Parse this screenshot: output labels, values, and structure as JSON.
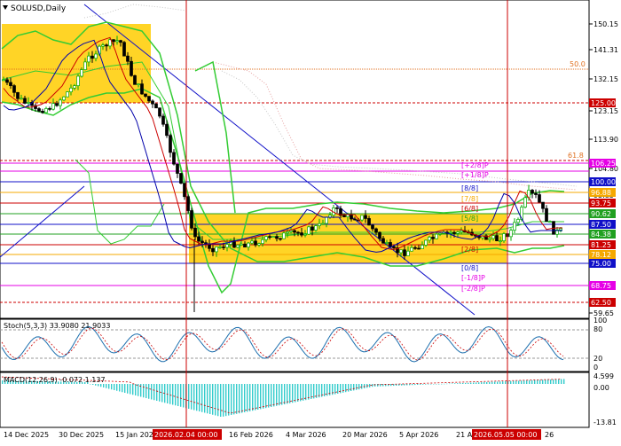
{
  "window": {
    "title": "SOLUSD,Daily"
  },
  "stochastic_panel": {
    "label": "Stoch(5,3,3) 33.9080 21.9033",
    "scale": [
      "100",
      "80",
      "20",
      "0"
    ]
  },
  "macd_panel": {
    "label": "MACD(12,26,9) -0.072 1.137",
    "scale": [
      "4.599",
      "0.00",
      "-13.81"
    ]
  },
  "price_scale": [
    "150.15",
    "141.31",
    "132.15",
    "123.15",
    "113.90",
    "104.80",
    "95.85",
    "86.88",
    "77.96",
    "68.87",
    "59.65"
  ],
  "price_badges": [
    {
      "text": "125.00",
      "color": "#cc0000"
    },
    {
      "text": "106.25",
      "color": "#e600e6"
    },
    {
      "text": "100.00",
      "color": "#1010c8"
    },
    {
      "text": "96.88",
      "color": "#f5a800"
    },
    {
      "text": "93.75",
      "color": "#cc0000"
    },
    {
      "text": "90.62",
      "color": "#20a020"
    },
    {
      "text": "87.50",
      "color": "#1010c8"
    },
    {
      "text": "84.38",
      "color": "#20a020"
    },
    {
      "text": "81.25",
      "color": "#cc0000"
    },
    {
      "text": "78.12",
      "color": "#f5a800"
    },
    {
      "text": "75.00",
      "color": "#1010c8"
    },
    {
      "text": "68.75",
      "color": "#e600e6"
    },
    {
      "text": "62.50",
      "color": "#cc0000"
    }
  ],
  "fib_labels": [
    "50.0",
    "61.8"
  ],
  "murrey_labels": [
    {
      "text": "[+2/8]P",
      "color": "#e600e6"
    },
    {
      "text": "[+1/8]P",
      "color": "#e600e6"
    },
    {
      "text": "[8/8]",
      "color": "#1010c8"
    },
    {
      "text": "[7/8]",
      "color": "#f5a800"
    },
    {
      "text": "[6/8]",
      "color": "#cc0000"
    },
    {
      "text": "[5/8]",
      "color": "#20a020"
    },
    {
      "text": "[2/8]",
      "color": "#cc0000"
    },
    {
      "text": "[0/8]",
      "color": "#1010c8"
    },
    {
      "text": "[-1/8]P",
      "color": "#e600e6"
    },
    {
      "text": "[-2/8]P",
      "color": "#e600e6"
    }
  ],
  "date_labels": [
    "14 Dec 2025",
    "30 Dec 2025",
    "15 Jan 2026",
    "16 Feb 2026",
    "4 Mar 2026",
    "20 Mar 2026",
    "5 Apr 2026",
    "21 A",
    "2026.05.05 00:00"
  ],
  "time_cursor_label": "2026.02.04 00:00",
  "colors": {
    "bull_candle": "#00aa00",
    "bear_candle": "#000000",
    "bollinger": "#33cc33",
    "zone": "#ffcc00",
    "ma_fast": "#cc0000",
    "ma_slow": "#0000aa",
    "stochastic": "#1c6fae",
    "macd_hist": "#33cccc"
  },
  "icons": {
    "symbol_icon": "down-triangle-icon"
  }
}
